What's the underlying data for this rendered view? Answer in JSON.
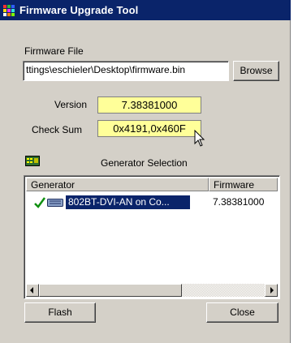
{
  "window": {
    "title": "Firmware Upgrade Tool",
    "icon": "app-color-grid-icon",
    "titlebar_color": "#0a246a"
  },
  "firmware_file": {
    "label": "Firmware File",
    "path_value": "ttings\\eschieler\\Desktop\\firmware.bin",
    "browse_label": "Browse"
  },
  "info": {
    "version_label": "Version",
    "version_value": "7.38381000",
    "checksum_label": "Check Sum",
    "checksum_value": "0x4191,0x460F",
    "highlight_color": "#ffff99"
  },
  "generator_selection": {
    "title": "Generator Selection",
    "icon": "generator-device-icon",
    "columns": [
      "Generator",
      "Firmware"
    ],
    "rows": [
      {
        "status_icon": "checkmark-icon",
        "device_icon": "device-icon",
        "name": "802BT-DVI-AN on Co...",
        "firmware": "7.38381000",
        "selected": true
      }
    ]
  },
  "buttons": {
    "flash_label": "Flash",
    "close_label": "Close"
  }
}
